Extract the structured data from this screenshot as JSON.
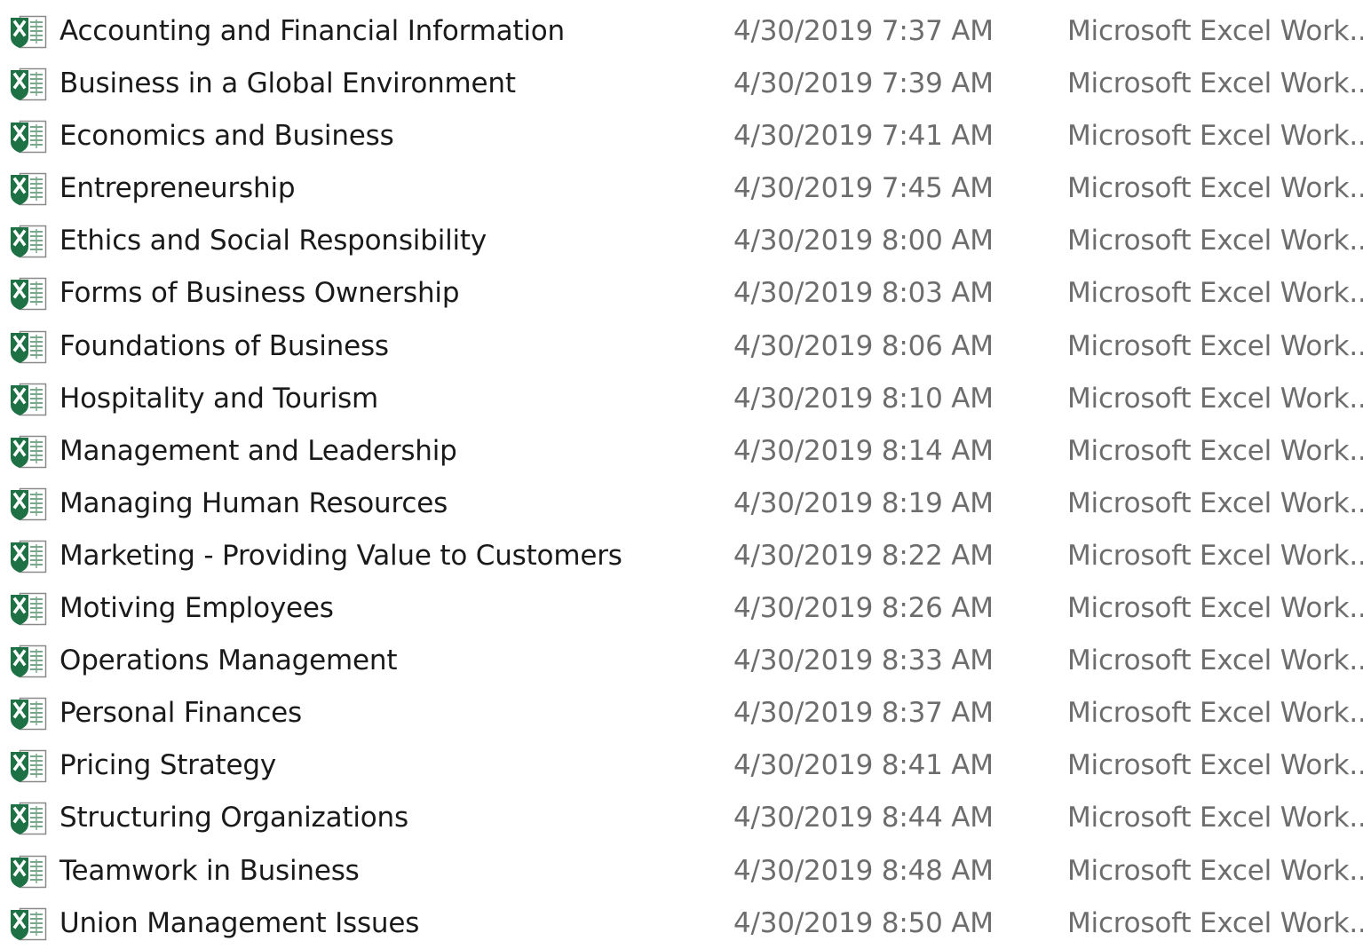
{
  "icon": "excel-workbook-icon",
  "colors": {
    "name_text": "#1a1a1a",
    "meta_text": "#6d6d6d",
    "excel_green": "#1e7145",
    "background": "#ffffff"
  },
  "files": [
    {
      "name": "Accounting and Financial Information",
      "date_modified": "4/30/2019 7:37 AM",
      "type": "Microsoft Excel Work..."
    },
    {
      "name": "Business in a Global Environment",
      "date_modified": "4/30/2019 7:39 AM",
      "type": "Microsoft Excel Work..."
    },
    {
      "name": "Economics and Business",
      "date_modified": "4/30/2019 7:41 AM",
      "type": "Microsoft Excel Work..."
    },
    {
      "name": "Entrepreneurship",
      "date_modified": "4/30/2019 7:45 AM",
      "type": "Microsoft Excel Work..."
    },
    {
      "name": "Ethics and Social Responsibility",
      "date_modified": "4/30/2019 8:00 AM",
      "type": "Microsoft Excel Work..."
    },
    {
      "name": "Forms of Business Ownership",
      "date_modified": "4/30/2019 8:03 AM",
      "type": "Microsoft Excel Work..."
    },
    {
      "name": "Foundations of Business",
      "date_modified": "4/30/2019 8:06 AM",
      "type": "Microsoft Excel Work..."
    },
    {
      "name": "Hospitality and Tourism",
      "date_modified": "4/30/2019 8:10 AM",
      "type": "Microsoft Excel Work..."
    },
    {
      "name": "Management and Leadership",
      "date_modified": "4/30/2019 8:14 AM",
      "type": "Microsoft Excel Work..."
    },
    {
      "name": "Managing Human Resources",
      "date_modified": "4/30/2019 8:19 AM",
      "type": "Microsoft Excel Work..."
    },
    {
      "name": "Marketing - Providing Value to Customers",
      "date_modified": "4/30/2019 8:22 AM",
      "type": "Microsoft Excel Work..."
    },
    {
      "name": "Motiving Employees",
      "date_modified": "4/30/2019 8:26 AM",
      "type": "Microsoft Excel Work..."
    },
    {
      "name": "Operations Management",
      "date_modified": "4/30/2019 8:33 AM",
      "type": "Microsoft Excel Work..."
    },
    {
      "name": "Personal Finances",
      "date_modified": "4/30/2019 8:37 AM",
      "type": "Microsoft Excel Work..."
    },
    {
      "name": "Pricing Strategy",
      "date_modified": "4/30/2019 8:41 AM",
      "type": "Microsoft Excel Work..."
    },
    {
      "name": "Structuring Organizations",
      "date_modified": "4/30/2019 8:44 AM",
      "type": "Microsoft Excel Work..."
    },
    {
      "name": "Teamwork in Business",
      "date_modified": "4/30/2019 8:48 AM",
      "type": "Microsoft Excel Work..."
    },
    {
      "name": "Union Management Issues",
      "date_modified": "4/30/2019 8:50 AM",
      "type": "Microsoft Excel Work..."
    }
  ]
}
